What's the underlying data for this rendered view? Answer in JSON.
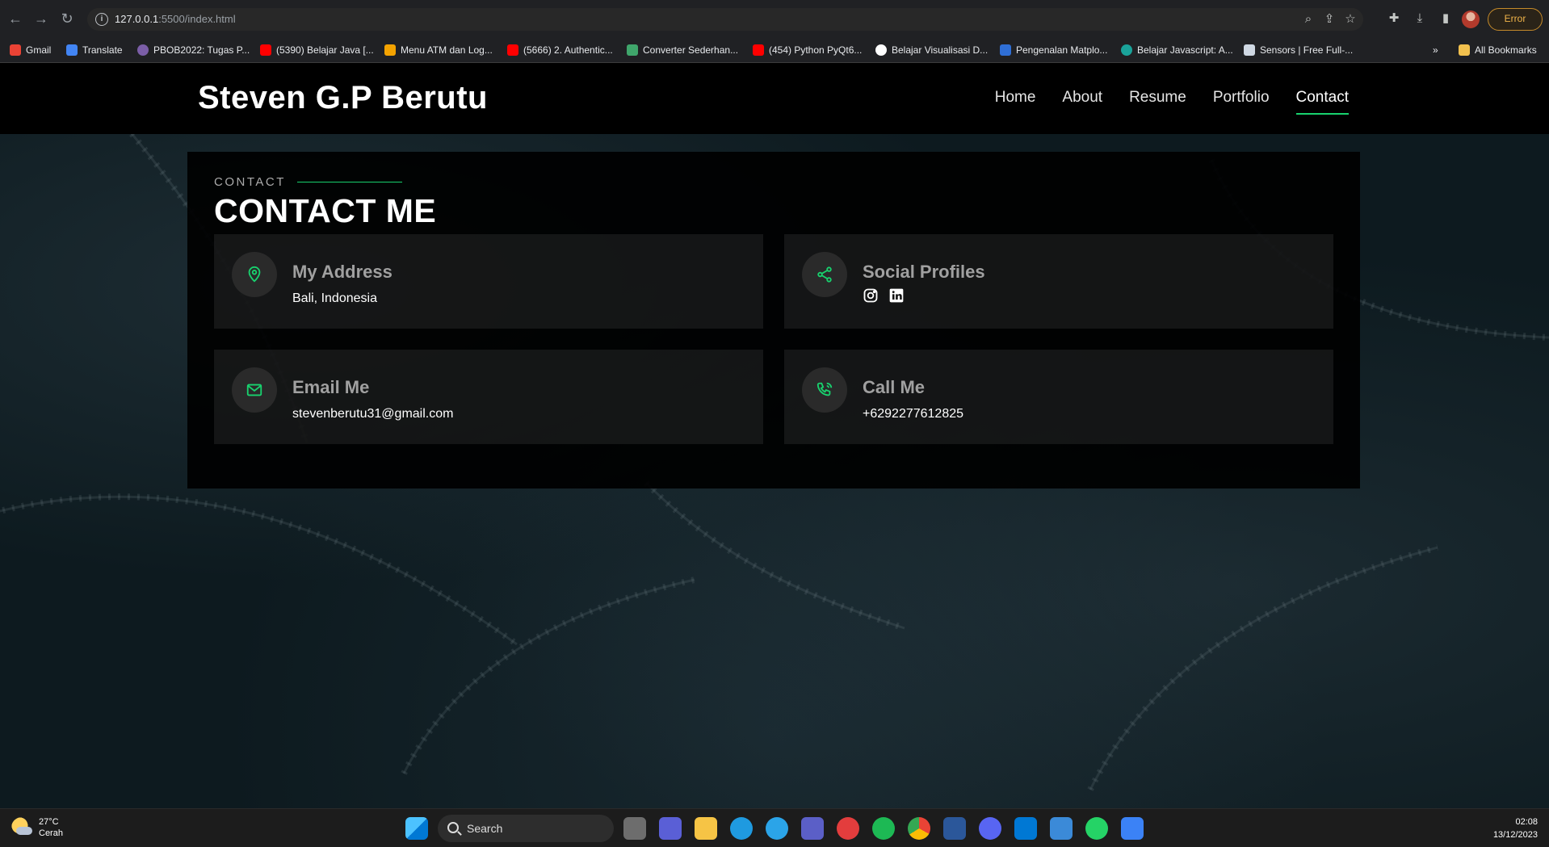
{
  "browser": {
    "url_host": "127.0.0.1",
    "url_path": ":5500/index.html",
    "error_label": "Error",
    "bookmarks": [
      {
        "label": "Gmail",
        "color": "#ea4335"
      },
      {
        "label": "Translate",
        "color": "#4285f4"
      },
      {
        "label": "PBOB2022: Tugas P...",
        "color": "#7b5ea7"
      },
      {
        "label": "(5390) Belajar Java [...",
        "color": "#ff0000"
      },
      {
        "label": "Menu ATM dan Log...",
        "color": "#f4a300"
      },
      {
        "label": "(5666) 2. Authentic...",
        "color": "#ff0000"
      },
      {
        "label": "Converter Sederhan...",
        "color": "#3fa66b"
      },
      {
        "label": "(454) Python PyQt6...",
        "color": "#ff0000"
      },
      {
        "label": "Belajar Visualisasi D...",
        "color": "#ffffff"
      },
      {
        "label": "Pengenalan Matplo...",
        "color": "#2f6fd6"
      },
      {
        "label": "Belajar Javascript: A...",
        "color": "#1aa39a"
      },
      {
        "label": "Sensors | Free Full-...",
        "color": "#cfd8e3"
      }
    ],
    "overflow_label": "»",
    "all_bookmarks_label": "All Bookmarks"
  },
  "site": {
    "logo": "Steven G.P Berutu",
    "nav": [
      "Home",
      "About",
      "Resume",
      "Portfolio",
      "Contact"
    ],
    "active_nav": "Contact",
    "accent": "#18d26e"
  },
  "contact": {
    "subtitle": "CONTACT",
    "title": "CONTACT ME",
    "address": {
      "title": "My Address",
      "text": "Bali, Indonesia",
      "icon": "map-pin-icon"
    },
    "social": {
      "title": "Social Profiles",
      "icon": "share-icon",
      "links": [
        "instagram-icon",
        "linkedin-icon"
      ]
    },
    "email": {
      "title": "Email Me",
      "text": "stevenberutu31@gmail.com",
      "icon": "envelope-icon"
    },
    "phone": {
      "title": "Call Me",
      "text": "+6292277612825",
      "icon": "phone-icon"
    }
  },
  "taskbar": {
    "temperature": "27°C",
    "weather": "Cerah",
    "search_label": "Search",
    "time": "02:08",
    "date": "13/12/2023"
  }
}
